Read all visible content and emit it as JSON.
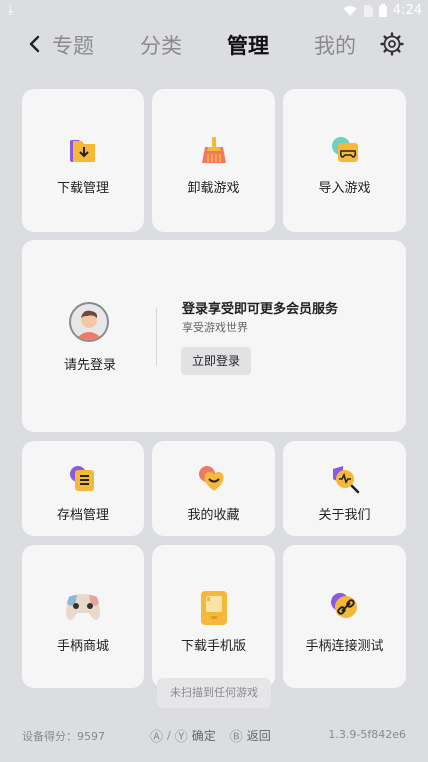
{
  "status": {
    "time": "4:24"
  },
  "nav": {
    "tabs": [
      "专题",
      "分类",
      "管理",
      "我的"
    ],
    "active": 2
  },
  "grid_top": [
    {
      "label": "下载管理",
      "icon": "download-folder-icon"
    },
    {
      "label": "卸载游戏",
      "icon": "broom-icon"
    },
    {
      "label": "导入游戏",
      "icon": "gamepad-import-icon"
    }
  ],
  "login": {
    "left_label": "请先登录",
    "title": "登录享受即可更多会员服务",
    "subtitle": "享受游戏世界",
    "button": "立即登录"
  },
  "grid_mid": [
    {
      "label": "存档管理",
      "icon": "save-list-icon"
    },
    {
      "label": "我的收藏",
      "icon": "heart-icon"
    },
    {
      "label": "关于我们",
      "icon": "search-heartbeat-icon"
    }
  ],
  "grid_bottom": [
    {
      "label": "手柄商城",
      "icon": "controller-icon"
    },
    {
      "label": "下载手机版",
      "icon": "phone-icon"
    },
    {
      "label": "手柄连接测试",
      "icon": "link-icon"
    }
  ],
  "toast": "未扫描到任何游戏",
  "footer": {
    "score": "设备得分：9597",
    "btn_a": "Ⓐ",
    "slash": "/",
    "btn_y": "Ⓨ",
    "confirm": "确定",
    "btn_b": "Ⓑ",
    "back": "返回",
    "version": "1.3.9-5f842e6"
  },
  "colors": {
    "accent": "#f5b83a",
    "purple": "#8a5be0",
    "coral": "#ee7a64"
  }
}
